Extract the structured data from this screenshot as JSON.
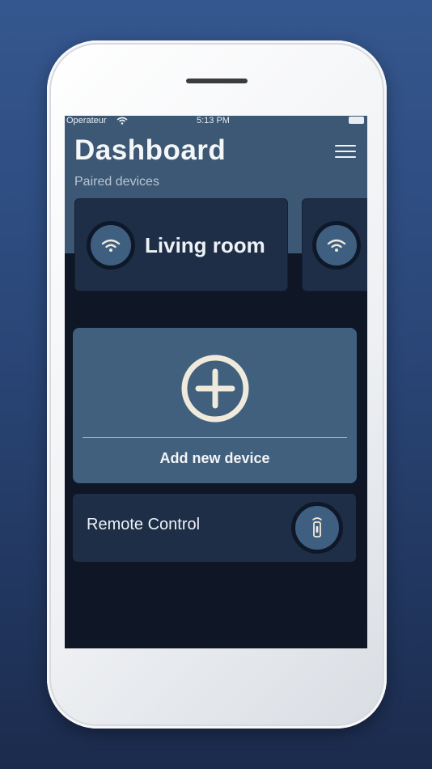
{
  "status_bar": {
    "carrier": "Operateur",
    "time": "5:13 PM"
  },
  "header": {
    "title": "Dashboard",
    "subtitle": "Paired devices"
  },
  "devices": [
    {
      "label": "Living room",
      "icon": "wifi-icon"
    },
    {
      "label": "",
      "icon": "wifi-icon"
    }
  ],
  "add_device": {
    "label": "Add new device",
    "icon": "plus-circle-icon"
  },
  "remote": {
    "label": "Remote Control",
    "icon": "remote-icon"
  },
  "colors": {
    "header_bg": "#3c5874",
    "screen_bg": "#0f1626",
    "card_bg": "#1e2e47",
    "add_card_bg": "#41607e",
    "icon_accent": "#efeadb"
  }
}
